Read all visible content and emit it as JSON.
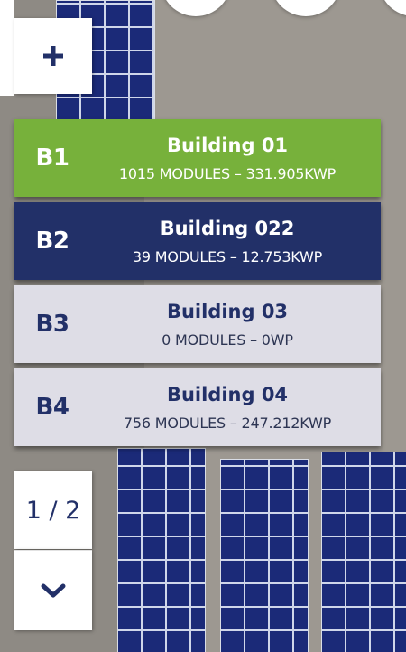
{
  "map": {
    "zoom_in_label": "+",
    "next_page_icon": "chevron-down-icon"
  },
  "pagination": {
    "label": "1 / 2"
  },
  "buildings": [
    {
      "code": "B1",
      "name": "Building 01",
      "stats": "1015 MODULES – 331.905KWP",
      "state": "selected-green"
    },
    {
      "code": "B2",
      "name": "Building 022",
      "stats": "39 MODULES – 12.753KWP",
      "state": "selected-navy"
    },
    {
      "code": "B3",
      "name": "Building 03",
      "stats": "0 MODULES – 0WP",
      "state": "default"
    },
    {
      "code": "B4",
      "name": "Building 04",
      "stats": "756 MODULES – 247.212KWP",
      "state": "default"
    }
  ],
  "colors": {
    "green": "#77b13b",
    "navy": "#223068",
    "light": "#dedde6"
  }
}
